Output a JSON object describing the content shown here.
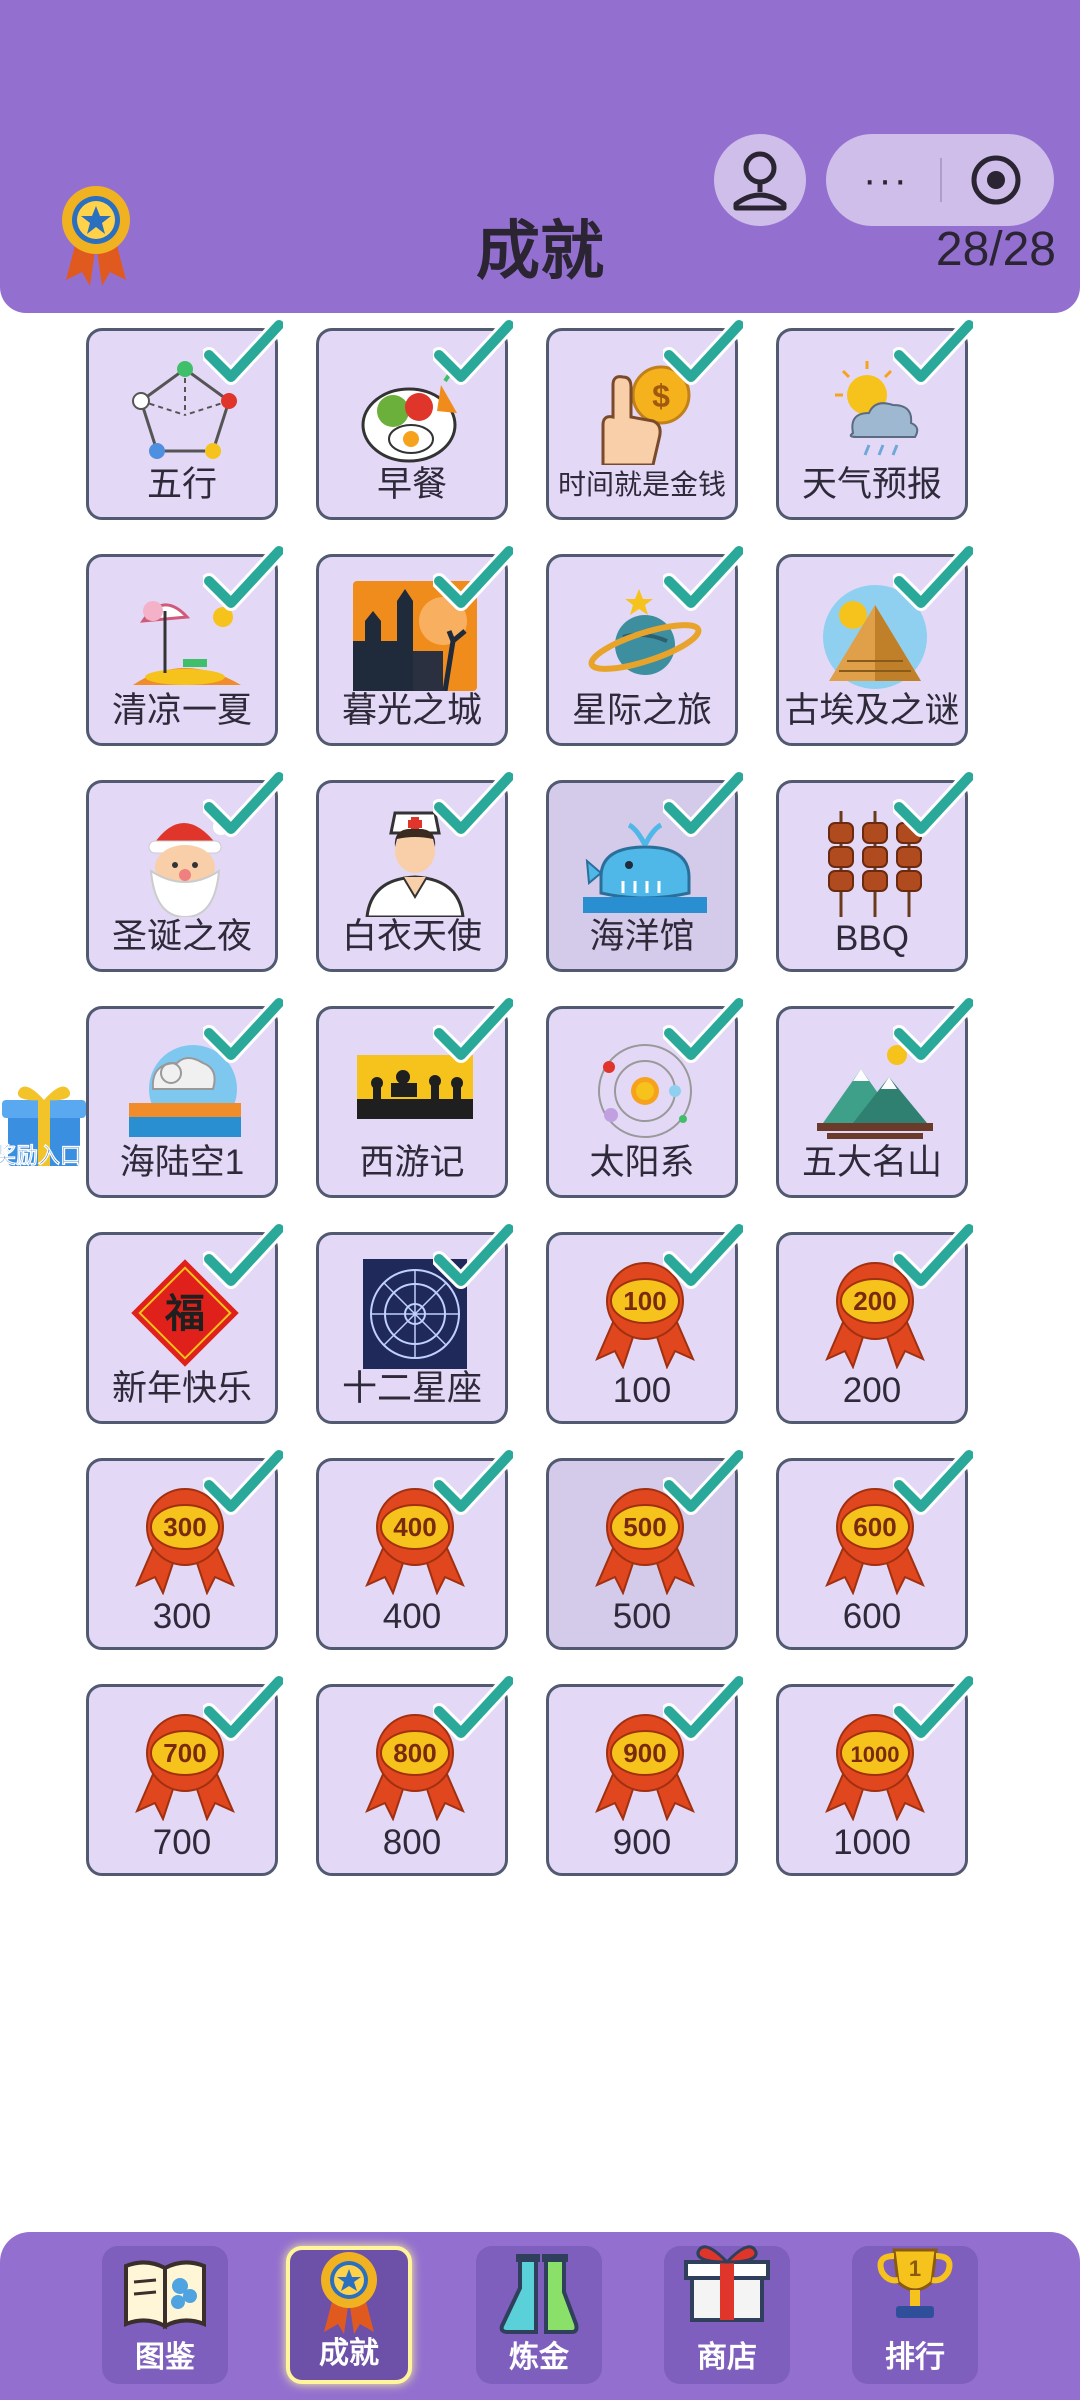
{
  "header": {
    "title": "成就",
    "counter": "28/28",
    "more_label": "···"
  },
  "achievements": [
    {
      "label": "五行",
      "icon": "five-elements-icon"
    },
    {
      "label": "早餐",
      "icon": "breakfast-icon"
    },
    {
      "label": "时间就是金钱",
      "icon": "coin-hand-icon"
    },
    {
      "label": "天气预报",
      "icon": "weather-icon"
    },
    {
      "label": "清凉一夏",
      "icon": "beach-icon"
    },
    {
      "label": "暮光之城",
      "icon": "twilight-castle-icon"
    },
    {
      "label": "星际之旅",
      "icon": "planet-icon"
    },
    {
      "label": "古埃及之谜",
      "icon": "pyramid-icon"
    },
    {
      "label": "圣诞之夜",
      "icon": "santa-icon"
    },
    {
      "label": "白衣天使",
      "icon": "nurse-icon"
    },
    {
      "label": "海洋馆",
      "icon": "whale-icon"
    },
    {
      "label": "BBQ",
      "icon": "skewers-icon"
    },
    {
      "label": "海陆空1",
      "icon": "land-sea-air-icon"
    },
    {
      "label": "西游记",
      "icon": "journey-west-icon"
    },
    {
      "label": "太阳系",
      "icon": "solar-system-icon"
    },
    {
      "label": "五大名山",
      "icon": "mountain-icon"
    },
    {
      "label": "新年快乐",
      "icon": "fu-icon",
      "badge_text": "福"
    },
    {
      "label": "十二星座",
      "icon": "zodiac-icon"
    },
    {
      "label": "100",
      "icon": "rosette-icon",
      "badge_text": "100"
    },
    {
      "label": "200",
      "icon": "rosette-icon",
      "badge_text": "200"
    },
    {
      "label": "300",
      "icon": "rosette-icon",
      "badge_text": "300"
    },
    {
      "label": "400",
      "icon": "rosette-icon",
      "badge_text": "400"
    },
    {
      "label": "500",
      "icon": "rosette-icon",
      "badge_text": "500"
    },
    {
      "label": "600",
      "icon": "rosette-icon",
      "badge_text": "600"
    },
    {
      "label": "700",
      "icon": "rosette-icon",
      "badge_text": "700"
    },
    {
      "label": "800",
      "icon": "rosette-icon",
      "badge_text": "800"
    },
    {
      "label": "900",
      "icon": "rosette-icon",
      "badge_text": "900"
    },
    {
      "label": "1000",
      "icon": "rosette-icon",
      "badge_text": "1000"
    }
  ],
  "gift": {
    "label": "奖励入口"
  },
  "tabs": [
    {
      "label": "图鉴",
      "icon": "book-icon"
    },
    {
      "label": "成就",
      "icon": "medal-icon",
      "active": true
    },
    {
      "label": "炼金",
      "icon": "flask-icon"
    },
    {
      "label": "商店",
      "icon": "gift-box-icon"
    },
    {
      "label": "排行",
      "icon": "trophy-icon"
    }
  ],
  "colors": {
    "header": "#9370cf",
    "card": "#e3d9f7",
    "check": "#2aa89a",
    "rosette_ribbon": "#e0471f",
    "rosette_center": "#f6c21c"
  }
}
